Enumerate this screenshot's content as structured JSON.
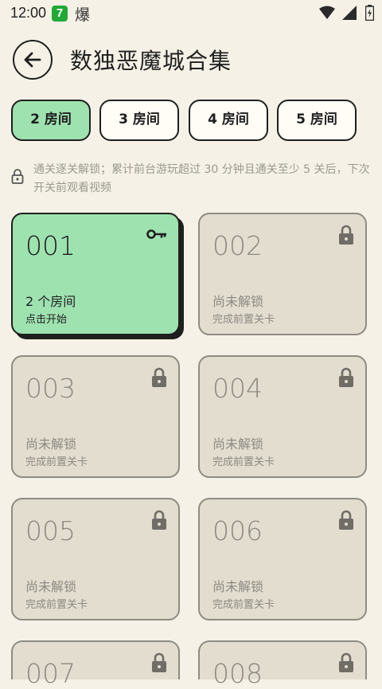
{
  "status": {
    "time": "12:00",
    "app1_glyph": "7",
    "app2_glyph": "爆"
  },
  "header": {
    "title": "数独恶魔城合集"
  },
  "tabs": [
    {
      "label": "2 房间",
      "active": true
    },
    {
      "label": "3 房间",
      "active": false
    },
    {
      "label": "4 房间",
      "active": false
    },
    {
      "label": "5 房间",
      "active": false
    }
  ],
  "notice": {
    "text": "通关逐关解锁；累计前台游玩超过 30 分钟且通关至少 5 关后，下次开关前观看视频"
  },
  "cards": [
    {
      "num": "001",
      "line1": "2 个房间",
      "line2": "点击开始",
      "state": "unlocked",
      "icon": "key-icon"
    },
    {
      "num": "002",
      "line1": "尚未解锁",
      "line2": "完成前置关卡",
      "state": "locked",
      "icon": "lock-icon"
    },
    {
      "num": "003",
      "line1": "尚未解锁",
      "line2": "完成前置关卡",
      "state": "locked",
      "icon": "lock-icon"
    },
    {
      "num": "004",
      "line1": "尚未解锁",
      "line2": "完成前置关卡",
      "state": "locked",
      "icon": "lock-icon"
    },
    {
      "num": "005",
      "line1": "尚未解锁",
      "line2": "完成前置关卡",
      "state": "locked",
      "icon": "lock-icon"
    },
    {
      "num": "006",
      "line1": "尚未解锁",
      "line2": "完成前置关卡",
      "state": "locked",
      "icon": "lock-icon"
    },
    {
      "num": "007",
      "line1": "",
      "line2": "",
      "state": "locked",
      "icon": "lock-icon"
    },
    {
      "num": "008",
      "line1": "",
      "line2": "",
      "state": "locked",
      "icon": "lock-icon"
    }
  ],
  "colors": {
    "background": "#f5f1e6",
    "accent_green": "#9ee2b0",
    "locked_card": "#e3ddcf"
  }
}
